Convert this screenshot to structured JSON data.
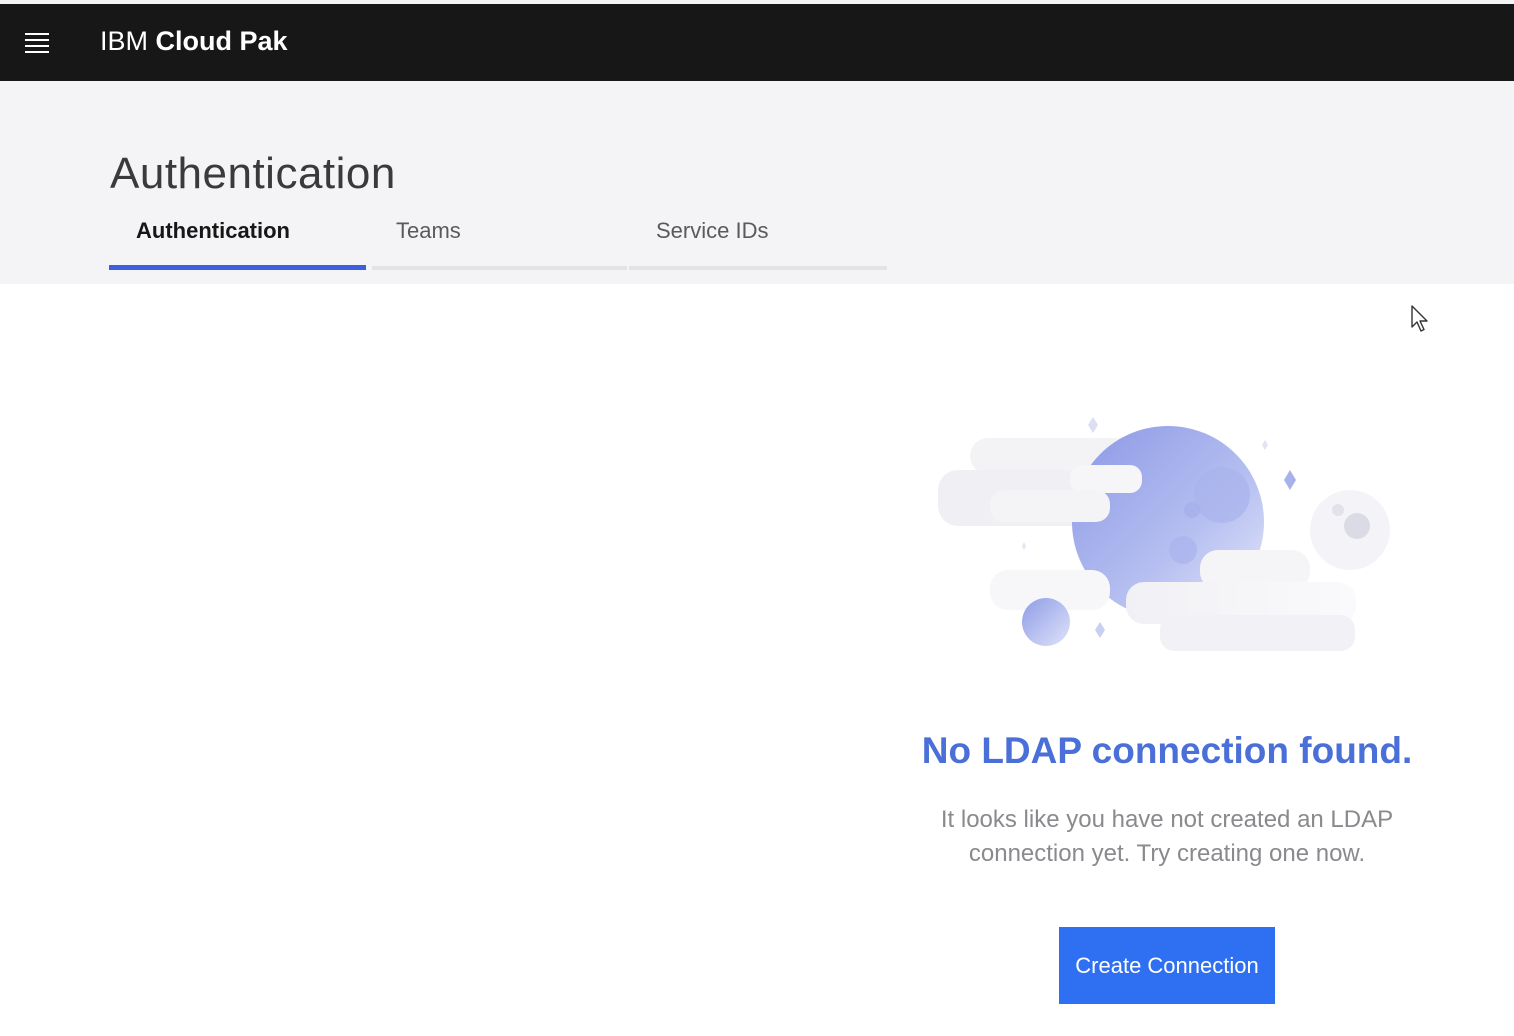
{
  "masthead": {
    "menu_icon": "hamburger-menu-icon",
    "brand_prefix": "IBM",
    "brand_name": "Cloud Pak"
  },
  "page": {
    "title": "Authentication",
    "tabs": [
      {
        "label": "Authentication",
        "active": true
      },
      {
        "label": "Teams",
        "active": false
      },
      {
        "label": "Service IDs",
        "active": false
      }
    ]
  },
  "empty_state": {
    "illustration": "planet-clouds-illustration",
    "title": "No LDAP connection found.",
    "description": "It looks like you have not created an LDAP connection yet. Try creating one now.",
    "button_label": "Create Connection"
  },
  "colors": {
    "masthead_bg": "#171717",
    "header_bg": "#f4f4f6",
    "accent": "#3b5fe0",
    "title_blue": "#4a6fd8",
    "button_bg": "#2f6ff2"
  }
}
